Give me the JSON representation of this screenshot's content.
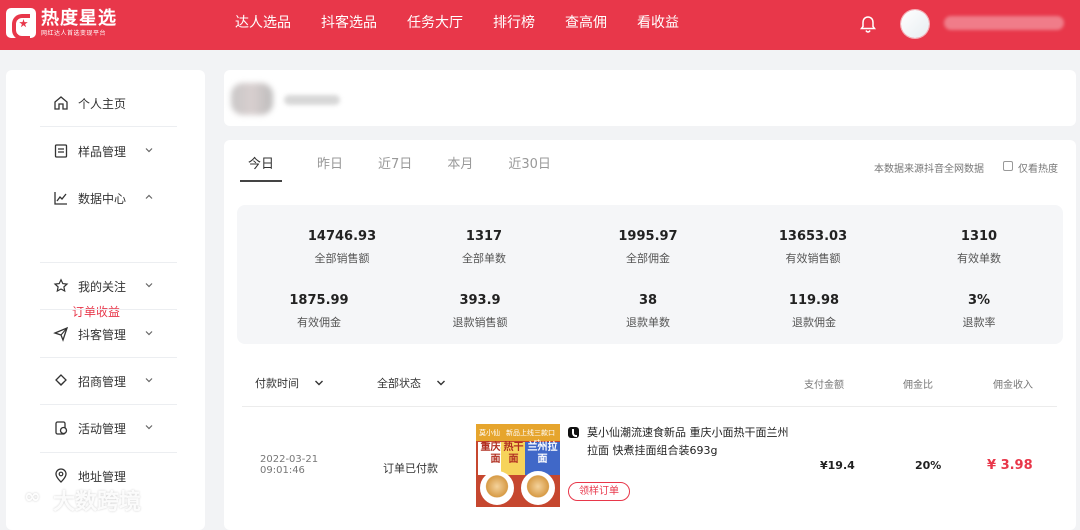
{
  "brand": {
    "title": "热度星选",
    "subtitle": "网红达人首选变现平台"
  },
  "nav": [
    "达人选品",
    "抖客选品",
    "任务大厅",
    "排行榜",
    "查高佣",
    "看收益"
  ],
  "sidebar": {
    "items": [
      {
        "label": "个人主页",
        "icon": "home-icon"
      },
      {
        "label": "样品管理",
        "icon": "sample-icon"
      },
      {
        "label": "数据中心",
        "icon": "chart-icon"
      },
      {
        "label": "我的关注",
        "icon": "star-icon"
      },
      {
        "label": "抖客管理",
        "icon": "send-icon"
      },
      {
        "label": "招商管理",
        "icon": "merchant-icon"
      },
      {
        "label": "活动管理",
        "icon": "activity-icon"
      },
      {
        "label": "地址管理",
        "icon": "location-icon"
      }
    ],
    "sub_item": "订单收益"
  },
  "tabs": [
    "今日",
    "昨日",
    "近7日",
    "本月",
    "近30日"
  ],
  "data_note": "本数据来源抖音全网数据",
  "checkbox_label": "仅看热度",
  "stats": [
    {
      "value": "14746.93",
      "label": "全部销售额"
    },
    {
      "value": "1317",
      "label": "全部单数"
    },
    {
      "value": "1995.97",
      "label": "全部佣金"
    },
    {
      "value": "13653.03",
      "label": "有效销售额"
    },
    {
      "value": "1310",
      "label": "有效单数"
    },
    {
      "value": "1875.99",
      "label": "有效佣金"
    },
    {
      "value": "393.9",
      "label": "退款销售额"
    },
    {
      "value": "38",
      "label": "退款单数"
    },
    {
      "value": "119.98",
      "label": "退款佣金"
    },
    {
      "value": "3%",
      "label": "退款率"
    }
  ],
  "filters": {
    "time": "付款时间",
    "status": "全部状态"
  },
  "columns": {
    "pay": "支付金额",
    "ratio": "佣金比",
    "income": "佣金收入"
  },
  "order": {
    "date": "2022-03-21",
    "time": "09:01:46",
    "status": "订单已付款",
    "product_name": "莫小仙潮流速食新品 重庆小面热干面兰州拉面 快煮挂面组合装693g",
    "sample": "领样订单",
    "pay": "¥19.4",
    "ratio": "20%",
    "income": "¥ 3.98"
  },
  "product_image_text": {
    "band_left": "莫小仙",
    "band_mid": "新品上线",
    "band_right": "三款口味",
    "box1": "重庆小面",
    "box2": "热干面",
    "box3": "兰州拉面"
  },
  "watermark": "大数跨境"
}
